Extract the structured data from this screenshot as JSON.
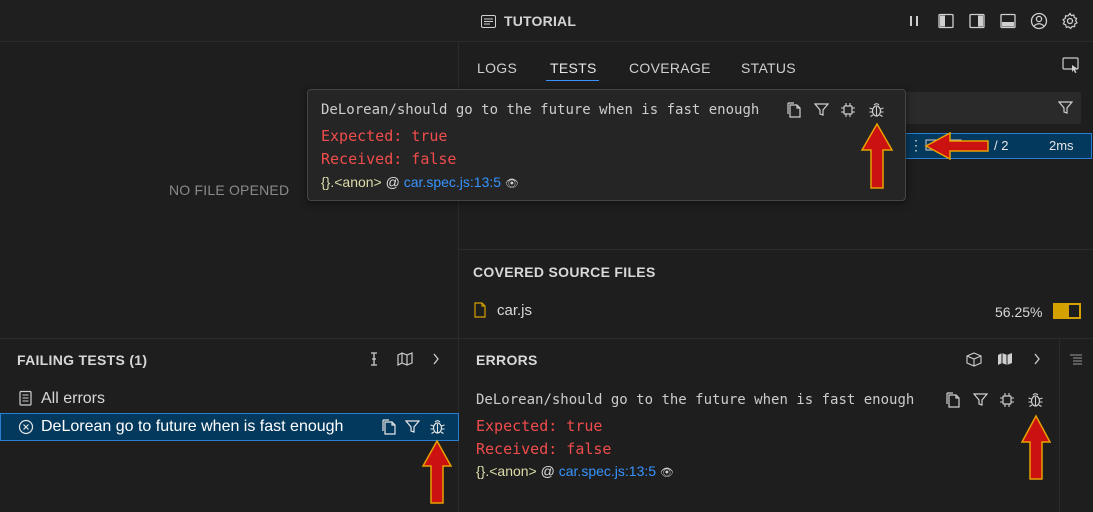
{
  "titlebar": {
    "title": "TUTORIAL"
  },
  "editor": {
    "empty_text": "NO FILE OPENED"
  },
  "tabs": [
    {
      "label": "LOGS"
    },
    {
      "label": "TESTS"
    },
    {
      "label": "COVERAGE"
    },
    {
      "label": "STATUS"
    }
  ],
  "test_row": {
    "count": "/ 2",
    "duration": "2ms"
  },
  "coverage": {
    "title": "COVERED SOURCE FILES",
    "files": [
      {
        "name": "car.js",
        "percent": "56.25%",
        "value": 0.5625
      }
    ]
  },
  "popup": {
    "suite": "DeLorean",
    "separator": "/",
    "test_name": "should go to the future when is fast enough",
    "expected": "Expected: true",
    "received": "Received: false",
    "frame": "{}.<anon>",
    "at": "@",
    "location": "car.spec.js:13:5"
  },
  "failing": {
    "title": "FAILING TESTS (1)",
    "all_errors": "All errors",
    "item": "DeLorean go to future when is fast enough"
  },
  "errors": {
    "title": "ERRORS",
    "suite": "DeLorean",
    "separator": "/",
    "test_name": "should go to the future when is fast enough",
    "expected": "Expected: true",
    "received": "Received: false",
    "frame": "{}.<anon>",
    "at": "@",
    "location": "car.spec.js:13:5"
  },
  "colors": {
    "accent": "#3794ff",
    "error": "#f14c4c",
    "selection": "#04395e",
    "coverage": "#d4a200",
    "arrow": "#cc1111"
  }
}
